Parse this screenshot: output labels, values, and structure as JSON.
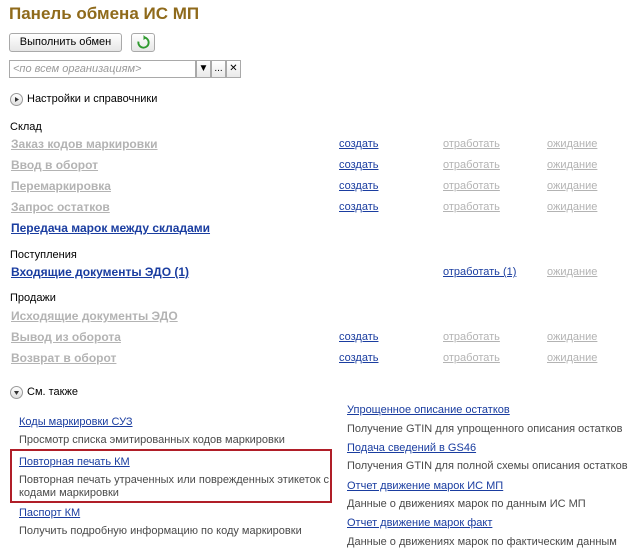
{
  "header": {
    "title": "Панель обмена ИС МП"
  },
  "toolbar": {
    "exchange_label": "Выполнить обмен",
    "refresh_icon": "refresh-icon"
  },
  "org_filter": {
    "placeholder": "<по всем организациям>",
    "dropdown_glyph": "▼",
    "select_glyph": "...",
    "clear_glyph": "✕"
  },
  "settings": {
    "label": "Настройки и справочники"
  },
  "sections": {
    "warehouse": {
      "label": "Склад",
      "rows": [
        {
          "name": "Заказ кодов маркировки",
          "create": "создать",
          "process": "отработать",
          "wait": "ожидание"
        },
        {
          "name": "Ввод в оборот",
          "create": "создать",
          "process": "отработать",
          "wait": "ожидание"
        },
        {
          "name": "Перемаркировка",
          "create": "создать",
          "process": "отработать",
          "wait": "ожидание"
        },
        {
          "name": "Запрос остатков",
          "create": "создать",
          "process": "отработать",
          "wait": "ожидание"
        },
        {
          "name": "Передача марок между складами"
        }
      ]
    },
    "incoming": {
      "label": "Поступления",
      "rows": [
        {
          "name": "Входящие документы ЭДО (1)",
          "process": "отработать (1)",
          "wait": "ожидание"
        }
      ]
    },
    "sales": {
      "label": "Продажи",
      "rows": [
        {
          "name": "Исходящие документы ЭДО"
        },
        {
          "name": "Вывод из оборота",
          "create": "создать",
          "process": "отработать",
          "wait": "ожидание"
        },
        {
          "name": "Возврат в оборот",
          "create": "создать",
          "process": "отработать",
          "wait": "ожидание"
        }
      ]
    }
  },
  "see_also": {
    "label": "См. также",
    "left": [
      {
        "link": "Коды маркировки СУЗ",
        "desc": "Просмотр списка эмитированных кодов маркировки"
      },
      {
        "link": "Повторная печать КМ",
        "desc1": "Повторная печать утраченных или поврежденных этикеток с",
        "desc2": "кодами маркировки"
      },
      {
        "link": "Паспорт КМ",
        "desc": "Получить подробную информацию по коду маркировки"
      }
    ],
    "right": [
      {
        "link": "Упрощенное описание остатков",
        "desc": "Получение GTIN для упрощенного описания остатков"
      },
      {
        "link": "Подача сведений в GS46",
        "desc": "Получения GTIN для полной схемы описания остатков"
      },
      {
        "link": "Отчет движение марок ИС МП",
        "desc": "Данные о движениях марок по данным ИС МП"
      },
      {
        "link": "Отчет движение марок факт",
        "desc": "Данные о движениях марок по фактическим данным"
      }
    ]
  },
  "colors": {
    "title": "#8f6a1b",
    "link": "#1a3da0",
    "disabled": "#b3b3b3",
    "highlight": "#b01e28"
  }
}
